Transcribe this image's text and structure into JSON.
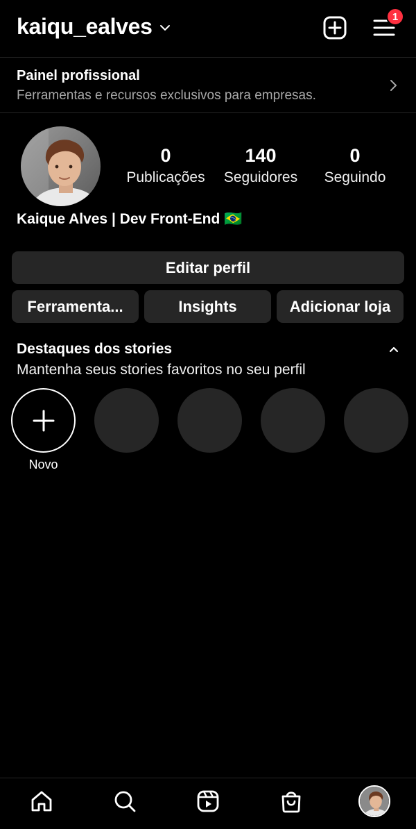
{
  "header": {
    "username": "kaiqu_ealves",
    "notification_count": "1"
  },
  "pro_panel": {
    "title": "Painel profissional",
    "subtitle": "Ferramentas e recursos exclusivos para empresas."
  },
  "profile": {
    "display_name": "Kaique Alves | Dev Front-End 🇧🇷",
    "stats": [
      {
        "value": "0",
        "label": "Publicações"
      },
      {
        "value": "140",
        "label": "Seguidores"
      },
      {
        "value": "0",
        "label": "Seguindo"
      }
    ]
  },
  "buttons": {
    "edit_profile": "Editar perfil",
    "tools": "Ferramenta...",
    "insights": "Insights",
    "add_shop": "Adicionar loja"
  },
  "highlights": {
    "title": "Destaques dos stories",
    "subtitle": "Mantenha seus stories favoritos no seu perfil",
    "new_label": "Novo"
  },
  "colors": {
    "background": "#000000",
    "surface": "#262626",
    "badge": "#ff3040",
    "secondary_text": "#a8a8a8"
  },
  "icons": [
    "chevron-down-icon",
    "new-post-icon",
    "menu-icon",
    "chevron-right-icon",
    "chevron-up-icon",
    "plus-icon",
    "home-icon",
    "search-icon",
    "reels-icon",
    "shop-icon",
    "profile-avatar-icon"
  ]
}
